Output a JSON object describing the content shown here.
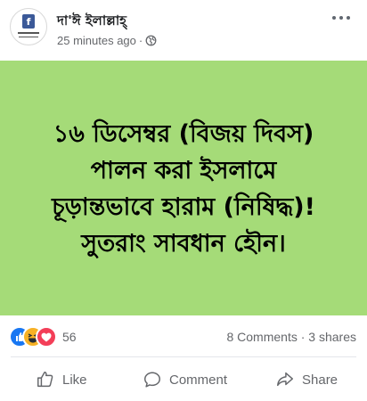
{
  "post": {
    "author": "দা'ঈ ইলাল্লাহ্",
    "time": "25 minutes ago",
    "separator": "·",
    "privacy_icon": "globe-icon",
    "menu_icon": "more-options-icon"
  },
  "image": {
    "background_color": "#a5db78",
    "lines": [
      "১৬ ডিসেম্বর (বিজয় দিবস)",
      "পালন করা ইসলামে",
      "চূড়ান্তভাবে হারাম (নিষিদ্ধ)!",
      "সুতরাং সাবধান হৌন।"
    ]
  },
  "engagement": {
    "reaction_icons": [
      "like-reaction-icon",
      "haha-reaction-icon",
      "love-reaction-icon"
    ],
    "reaction_count": "56",
    "comments": "8 Comments",
    "shares": "3 shares",
    "summary_separator": "·"
  },
  "actions": {
    "like": "Like",
    "comment": "Comment",
    "share": "Share"
  },
  "colors": {
    "accent": "#1877f2",
    "muted_text": "#65676b"
  }
}
